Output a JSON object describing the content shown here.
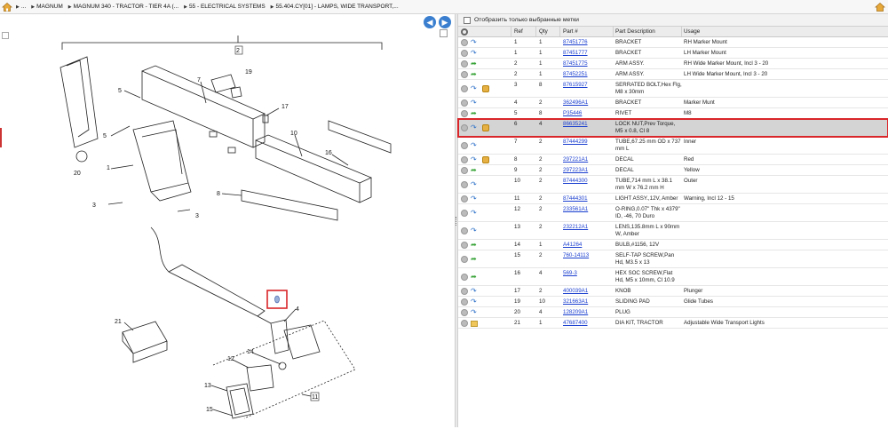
{
  "breadcrumb": {
    "items": [
      "...",
      "MAGNUM",
      "MAGNUM 340 - TRACTOR - TIER 4A (...",
      "55 - ELECTRICAL SYSTEMS",
      "55.404.CY[01] - LAMPS, WIDE TRANSPORT,..."
    ]
  },
  "diagram": {
    "callouts": [
      "2",
      "7",
      "19",
      "5",
      "5",
      "17",
      "10",
      "16",
      "20",
      "1",
      "3",
      "3",
      "8",
      "4",
      "21",
      "14",
      "12",
      "13",
      "15",
      "11"
    ]
  },
  "filter": {
    "label": "Отобразить только выбранные метки"
  },
  "table": {
    "headers": {
      "ref": "Ref",
      "qty": "Qty",
      "part": "Part #",
      "desc": "Part Description",
      "usage": "Usage"
    },
    "rows": [
      {
        "ref": "1",
        "qty": "1",
        "part": "87451776",
        "desc": "BRACKET",
        "usage": "RH Marker Mount",
        "arrow": "blue",
        "box": false
      },
      {
        "ref": "1",
        "qty": "1",
        "part": "87451777",
        "desc": "BRACKET",
        "usage": "LH Marker Mount",
        "arrow": "blue",
        "box": false
      },
      {
        "ref": "2",
        "qty": "1",
        "part": "87451775",
        "desc": "ARM ASSY.",
        "usage": "RH Wide Marker Mount, Incl 3 - 20",
        "arrow": "green",
        "box": false
      },
      {
        "ref": "2",
        "qty": "1",
        "part": "87452251",
        "desc": "ARM ASSY.",
        "usage": "LH Wide Marker Mount, Incl 3 - 20",
        "arrow": "green",
        "box": false
      },
      {
        "ref": "3",
        "qty": "8",
        "part": "87615927",
        "desc": "SERRATED BOLT,Hex Flg, M8 x 30mm",
        "usage": "",
        "arrow": "blue",
        "box": true
      },
      {
        "ref": "4",
        "qty": "2",
        "part": "362496A1",
        "desc": "BRACKET",
        "usage": "Marker Munt",
        "arrow": "blue",
        "box": false
      },
      {
        "ref": "5",
        "qty": "8",
        "part": "P35446",
        "desc": "RIVET",
        "usage": "M8",
        "arrow": "green",
        "box": false
      },
      {
        "ref": "6",
        "qty": "4",
        "part": "86635241",
        "desc": "LOCK NUT,Prev Torque, M5 x 0.8, Cl 8",
        "usage": "",
        "arrow": "blue",
        "box": true,
        "selected": true
      },
      {
        "ref": "7",
        "qty": "2",
        "part": "87444299",
        "desc": "TUBE,67.25 mm OD x 737 mm L",
        "usage": "Inner",
        "arrow": "blue",
        "box": false
      },
      {
        "ref": "8",
        "qty": "2",
        "part": "297221A1",
        "desc": "DECAL",
        "usage": "Red",
        "arrow": "blue",
        "box": true
      },
      {
        "ref": "9",
        "qty": "2",
        "part": "297223A1",
        "desc": "DECAL",
        "usage": "Yellow",
        "arrow": "green",
        "box": false
      },
      {
        "ref": "10",
        "qty": "2",
        "part": "87444300",
        "desc": "TUBE,714 mm L x 38.1 mm W x 76.2 mm H",
        "usage": "Outer",
        "arrow": "blue",
        "box": false
      },
      {
        "ref": "11",
        "qty": "2",
        "part": "87444301",
        "desc": "LIGHT ASSY.,12V, Amber",
        "usage": "Warning, Incl 12 - 15",
        "arrow": "blue",
        "box": false
      },
      {
        "ref": "12",
        "qty": "2",
        "part": "233561A1",
        "desc": "O-RING,0.07\" Thk x 4379\" ID, -46, 70 Duro",
        "usage": "",
        "arrow": "blue",
        "box": false
      },
      {
        "ref": "13",
        "qty": "2",
        "part": "232212A1",
        "desc": "LENS,135.8mm L x 90mm W, Amber",
        "usage": "",
        "arrow": "blue",
        "box": false
      },
      {
        "ref": "14",
        "qty": "1",
        "part": "A41264",
        "desc": "BULB,#1156, 12V",
        "usage": "",
        "arrow": "green",
        "box": false
      },
      {
        "ref": "15",
        "qty": "2",
        "part": "760-14113",
        "desc": "SELF-TAP SCREW,Pan Hd, M3.5 x 13",
        "usage": "",
        "arrow": "green",
        "box": false
      },
      {
        "ref": "16",
        "qty": "4",
        "part": "569-3",
        "desc": "HEX SOC SCREW,Flat Hd, M5 x 10mm, Cl 10.9",
        "usage": "",
        "arrow": "green",
        "box": false
      },
      {
        "ref": "17",
        "qty": "2",
        "part": "400039A1",
        "desc": "KNOB",
        "usage": "Plunger",
        "arrow": "blue",
        "box": false
      },
      {
        "ref": "19",
        "qty": "10",
        "part": "321663A1",
        "desc": "SLIDING PAD",
        "usage": "Glide Tubes",
        "arrow": "blue",
        "box": false
      },
      {
        "ref": "20",
        "qty": "4",
        "part": "128209A1",
        "desc": "PLUG",
        "usage": "",
        "arrow": "blue",
        "box": false
      },
      {
        "ref": "21",
        "qty": "1",
        "part": "47687400",
        "desc": "DIA KIT, TRACTOR",
        "usage": "Adjustable Wide Transport Lights",
        "arrow": "folder",
        "box": false
      }
    ]
  },
  "colors": {
    "link": "#1a3ecf",
    "selection_outline": "#d9262a",
    "nav_button": "#3a7fcf"
  }
}
